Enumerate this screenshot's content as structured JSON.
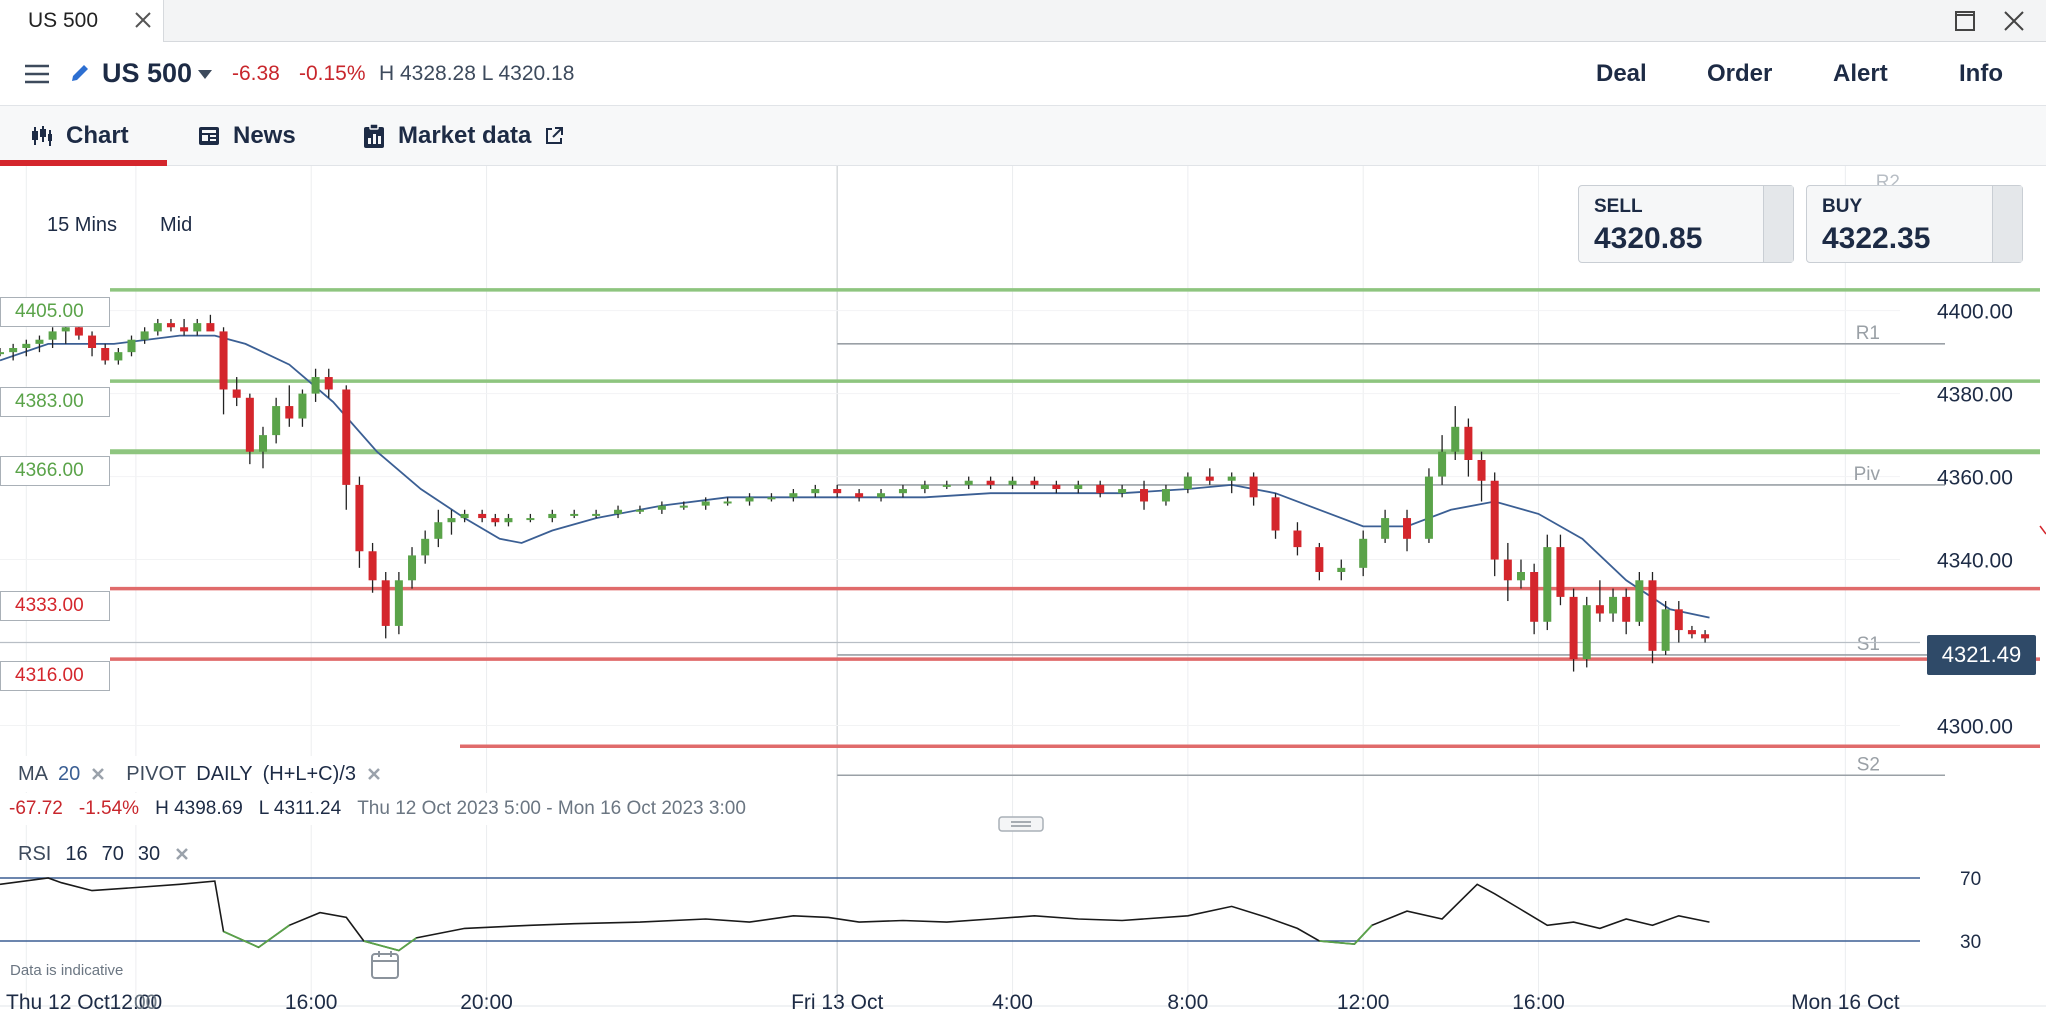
{
  "window": {
    "tab_title": "US 500"
  },
  "header": {
    "instrument": "US 500",
    "change_abs": "-6.38",
    "change_pct": "-0.15%",
    "high_low": "H 4328.28  L 4320.18",
    "buttons": {
      "deal": "Deal",
      "order": "Order",
      "alert": "Alert",
      "info": "Info"
    }
  },
  "tabs": {
    "chart": "Chart",
    "news": "News",
    "market_data": "Market data"
  },
  "chart_options": {
    "interval": "15 Mins",
    "price_type": "Mid"
  },
  "quote": {
    "sell_label": "SELL",
    "sell_value": "4320.85",
    "buy_label": "BUY",
    "buy_value": "4322.35"
  },
  "level_tags": {
    "l4405": "4405.00",
    "l4383": "4383.00",
    "l4366": "4366.00",
    "l4333": "4333.00",
    "l4316": "4316.00"
  },
  "last_price": "4321.49",
  "indicators": {
    "ma_label": "MA",
    "ma_period": "20",
    "pivot_label": "PIVOT",
    "pivot_period": "DAILY",
    "pivot_formula": "(H+L+C)/3"
  },
  "stats": {
    "change_abs": "-67.72",
    "change_pct": "-1.54%",
    "high": "H 4398.69",
    "low": "L 4311.24",
    "range": "Thu 12 Oct 2023 5:00 - Mon 16 Oct 2023 3:00"
  },
  "rsi": {
    "label": "RSI",
    "period": "16",
    "upper": "70",
    "lower": "30"
  },
  "disclaimer": "Data is indicative",
  "colors": {
    "up": "#5aa349",
    "down": "#d4262c",
    "ma": "#3b5f94",
    "rsi_oversold": "#5aa349",
    "support_line": "#8ec57f",
    "resistance_line": "#e06b6b",
    "brand_red": "#d4262c"
  },
  "chart_data": {
    "type": "candlestick",
    "interval": "15 Mins",
    "y_axis": {
      "min": 4283,
      "max": 4445,
      "ticks": [
        4300,
        4320,
        4340,
        4360,
        4380,
        4400
      ],
      "tick_labels": [
        "4300.00",
        "",
        "4340.00",
        "4360.00",
        "4380.00",
        "4400.00"
      ]
    },
    "x_axis": {
      "ticks": [
        {
          "t": 0.5,
          "label": "Thu 12 Oct"
        },
        {
          "t": 3,
          "label": "12:00"
        },
        {
          "t": 7,
          "label": "16:00"
        },
        {
          "t": 11,
          "label": "20:00"
        },
        {
          "t": 19,
          "label": "Fri 13 Oct"
        },
        {
          "t": 23,
          "label": "4:00"
        },
        {
          "t": 27,
          "label": "8:00"
        },
        {
          "t": 31,
          "label": "12:00"
        },
        {
          "t": 35,
          "label": "16:00"
        },
        {
          "t": 42,
          "label": "Mon 16 Oct"
        }
      ],
      "range": [
        -0.1,
        45.3
      ],
      "partial_label": "00"
    },
    "horizontal_levels": [
      {
        "value": 4405,
        "label": "4405.00",
        "color": "#8ec57f"
      },
      {
        "value": 4383,
        "label": "4383.00",
        "color": "#8ec57f"
      },
      {
        "value": 4366,
        "label": "4366.00",
        "color": "#8ec57f"
      },
      {
        "value": 4333,
        "label": "4333.00",
        "color": "#e06b6b"
      },
      {
        "value": 4316,
        "label": "4316.00",
        "color": "#e06b6b"
      },
      {
        "value": 4295,
        "label": "",
        "color": "#e06b6b"
      }
    ],
    "pivots": [
      {
        "name": "R2",
        "value": 4441
      },
      {
        "name": "R1",
        "value": 4392
      },
      {
        "name": "Piv",
        "value": 4358
      },
      {
        "name": "S1",
        "value": 4317
      },
      {
        "name": "S2",
        "value": 4288
      }
    ],
    "ohlc": [
      [
        -0.1,
        4390,
        4391,
        4389,
        4390
      ],
      [
        0.2,
        4390,
        4392,
        4388,
        4391
      ],
      [
        0.5,
        4391,
        4393,
        4389,
        4392
      ],
      [
        0.8,
        4392,
        4394,
        4390,
        4393
      ],
      [
        1.1,
        4393,
        4396,
        4391,
        4395
      ],
      [
        1.4,
        4395,
        4397,
        4392,
        4396
      ],
      [
        1.7,
        4396,
        4397,
        4393,
        4394
      ],
      [
        2.0,
        4394,
        4395,
        4389,
        4391
      ],
      [
        2.3,
        4391,
        4392,
        4387,
        4388
      ],
      [
        2.6,
        4388,
        4391,
        4387,
        4390
      ],
      [
        2.9,
        4390,
        4394,
        4389,
        4393
      ],
      [
        3.2,
        4393,
        4396,
        4392,
        4395
      ],
      [
        3.5,
        4395,
        4398,
        4394,
        4397
      ],
      [
        3.8,
        4397,
        4398,
        4395,
        4396
      ],
      [
        4.1,
        4396,
        4398,
        4394,
        4395
      ],
      [
        4.4,
        4395,
        4398,
        4394,
        4397
      ],
      [
        4.7,
        4397,
        4399,
        4396,
        4395
      ],
      [
        5.0,
        4395,
        4396,
        4375,
        4381
      ],
      [
        5.3,
        4381,
        4384,
        4377,
        4379
      ],
      [
        5.6,
        4379,
        4380,
        4363,
        4366
      ],
      [
        5.9,
        4366,
        4372,
        4362,
        4370
      ],
      [
        6.2,
        4370,
        4379,
        4368,
        4377
      ],
      [
        6.5,
        4377,
        4382,
        4372,
        4374
      ],
      [
        6.8,
        4374,
        4381,
        4372,
        4380
      ],
      [
        7.1,
        4380,
        4386,
        4378,
        4384
      ],
      [
        7.4,
        4384,
        4386,
        4379,
        4381
      ],
      [
        7.8,
        4381,
        4382,
        4352,
        4358
      ],
      [
        8.1,
        4358,
        4360,
        4338,
        4342
      ],
      [
        8.4,
        4342,
        4344,
        4332,
        4335
      ],
      [
        8.7,
        4335,
        4337,
        4321,
        4324
      ],
      [
        9.0,
        4324,
        4337,
        4322,
        4335
      ],
      [
        9.3,
        4335,
        4343,
        4333,
        4341
      ],
      [
        9.6,
        4341,
        4347,
        4339,
        4345
      ],
      [
        9.9,
        4345,
        4352,
        4343,
        4349
      ],
      [
        10.2,
        4349,
        4352,
        4346,
        4350
      ],
      [
        10.5,
        4350,
        4352,
        4349,
        4351
      ],
      [
        10.9,
        4351,
        4352,
        4349,
        4350
      ],
      [
        11.2,
        4350,
        4351,
        4348,
        4349
      ],
      [
        11.5,
        4349,
        4351,
        4348,
        4350
      ],
      [
        12.0,
        4350,
        4351,
        4349,
        4350
      ],
      [
        12.5,
        4350,
        4352,
        4349,
        4351
      ],
      [
        13.0,
        4351,
        4352,
        4350,
        4351
      ],
      [
        13.5,
        4351,
        4352,
        4350,
        4351
      ],
      [
        14.0,
        4351,
        4353,
        4350,
        4352
      ],
      [
        14.5,
        4352,
        4353,
        4351,
        4352
      ],
      [
        15.0,
        4352,
        4354,
        4351,
        4353
      ],
      [
        15.5,
        4353,
        4354,
        4352,
        4353
      ],
      [
        16.0,
        4353,
        4355,
        4352,
        4354
      ],
      [
        16.5,
        4354,
        4355,
        4353,
        4354
      ],
      [
        17.0,
        4354,
        4356,
        4353,
        4355
      ],
      [
        17.5,
        4355,
        4356,
        4354,
        4355
      ],
      [
        18.0,
        4355,
        4357,
        4354,
        4356
      ],
      [
        18.5,
        4356,
        4358,
        4355,
        4357
      ],
      [
        19.0,
        4357,
        4358,
        4355,
        4356
      ],
      [
        19.5,
        4356,
        4357,
        4354,
        4355
      ],
      [
        20.0,
        4355,
        4357,
        4354,
        4356
      ],
      [
        20.5,
        4356,
        4358,
        4355,
        4357
      ],
      [
        21.0,
        4357,
        4359,
        4356,
        4358
      ],
      [
        21.5,
        4358,
        4359,
        4357,
        4358
      ],
      [
        22.0,
        4358,
        4360,
        4357,
        4359
      ],
      [
        22.5,
        4359,
        4360,
        4357,
        4358
      ],
      [
        23.0,
        4358,
        4360,
        4357,
        4359
      ],
      [
        23.5,
        4359,
        4360,
        4357,
        4358
      ],
      [
        24.0,
        4358,
        4359,
        4356,
        4357
      ],
      [
        24.5,
        4357,
        4359,
        4356,
        4358
      ],
      [
        25.0,
        4358,
        4359,
        4355,
        4356
      ],
      [
        25.5,
        4356,
        4358,
        4355,
        4357
      ],
      [
        26.0,
        4357,
        4359,
        4352,
        4354
      ],
      [
        26.5,
        4354,
        4358,
        4353,
        4357
      ],
      [
        27.0,
        4357,
        4361,
        4356,
        4360
      ],
      [
        27.5,
        4360,
        4362,
        4358,
        4359
      ],
      [
        28.0,
        4359,
        4361,
        4356,
        4360
      ],
      [
        28.5,
        4360,
        4361,
        4353,
        4355
      ],
      [
        29.0,
        4355,
        4356,
        4345,
        4347
      ],
      [
        29.5,
        4347,
        4349,
        4341,
        4343
      ],
      [
        30.0,
        4343,
        4344,
        4335,
        4337
      ],
      [
        30.5,
        4337,
        4340,
        4335,
        4338
      ],
      [
        31.0,
        4338,
        4347,
        4336,
        4345
      ],
      [
        31.5,
        4345,
        4352,
        4344,
        4350
      ],
      [
        32.0,
        4350,
        4352,
        4342,
        4345
      ],
      [
        32.5,
        4345,
        4362,
        4344,
        4360
      ],
      [
        32.8,
        4360,
        4370,
        4358,
        4366
      ],
      [
        33.1,
        4366,
        4377,
        4364,
        4372
      ],
      [
        33.4,
        4372,
        4374,
        4360,
        4364
      ],
      [
        33.7,
        4364,
        4366,
        4354,
        4359
      ],
      [
        34.0,
        4359,
        4361,
        4336,
        4340
      ],
      [
        34.3,
        4340,
        4344,
        4330,
        4335
      ],
      [
        34.6,
        4335,
        4340,
        4333,
        4337
      ],
      [
        34.9,
        4337,
        4339,
        4322,
        4325
      ],
      [
        35.2,
        4325,
        4346,
        4323,
        4343
      ],
      [
        35.5,
        4343,
        4346,
        4329,
        4331
      ],
      [
        35.8,
        4331,
        4333,
        4313,
        4316
      ],
      [
        36.1,
        4316,
        4331,
        4314,
        4329
      ],
      [
        36.4,
        4329,
        4335,
        4325,
        4327
      ],
      [
        36.7,
        4327,
        4333,
        4325,
        4331
      ],
      [
        37.0,
        4331,
        4333,
        4322,
        4325
      ],
      [
        37.3,
        4325,
        4337,
        4324,
        4335
      ],
      [
        37.6,
        4335,
        4337,
        4315,
        4318
      ],
      [
        37.9,
        4318,
        4330,
        4317,
        4328
      ],
      [
        38.2,
        4328,
        4330,
        4320,
        4323
      ],
      [
        38.5,
        4323,
        4324,
        4321,
        4322
      ],
      [
        38.8,
        4322,
        4323,
        4320,
        4321
      ]
    ],
    "ma20": [
      [
        -0.1,
        4388
      ],
      [
        1.0,
        4392
      ],
      [
        2.5,
        4392
      ],
      [
        4.0,
        4394
      ],
      [
        4.8,
        4394
      ],
      [
        5.5,
        4392
      ],
      [
        6.5,
        4387
      ],
      [
        7.5,
        4378
      ],
      [
        8.5,
        4366
      ],
      [
        9.5,
        4357
      ],
      [
        10.5,
        4350
      ],
      [
        11.3,
        4345
      ],
      [
        11.8,
        4344
      ],
      [
        12.5,
        4347
      ],
      [
        13.5,
        4350
      ],
      [
        15.0,
        4353
      ],
      [
        16.5,
        4355
      ],
      [
        18.0,
        4355
      ],
      [
        19.5,
        4355
      ],
      [
        21.0,
        4355
      ],
      [
        22.5,
        4356
      ],
      [
        24.0,
        4356
      ],
      [
        25.5,
        4356
      ],
      [
        27.0,
        4357
      ],
      [
        28.0,
        4358
      ],
      [
        29.0,
        4356
      ],
      [
        30.0,
        4352
      ],
      [
        31.0,
        4348
      ],
      [
        32.0,
        4348
      ],
      [
        33.0,
        4352
      ],
      [
        34.0,
        4354
      ],
      [
        35.0,
        4351
      ],
      [
        36.0,
        4345
      ],
      [
        37.0,
        4335
      ],
      [
        38.0,
        4328
      ],
      [
        38.9,
        4326
      ]
    ],
    "rsi": {
      "upper": 70,
      "lower": 30,
      "values": [
        [
          -0.1,
          66
        ],
        [
          1.0,
          70
        ],
        [
          1.3,
          67
        ],
        [
          2.0,
          62
        ],
        [
          3.0,
          64
        ],
        [
          4.0,
          66
        ],
        [
          4.8,
          68
        ],
        [
          5.0,
          36
        ],
        [
          5.8,
          26
        ],
        [
          6.5,
          40
        ],
        [
          7.2,
          48
        ],
        [
          7.8,
          45
        ],
        [
          8.2,
          30
        ],
        [
          9.0,
          24
        ],
        [
          9.4,
          32
        ],
        [
          10.5,
          38
        ],
        [
          12.0,
          40
        ],
        [
          13.0,
          41
        ],
        [
          14.5,
          42
        ],
        [
          16.0,
          44
        ],
        [
          17.0,
          42
        ],
        [
          18.0,
          46
        ],
        [
          18.8,
          45
        ],
        [
          19.5,
          42
        ],
        [
          20.5,
          43
        ],
        [
          21.5,
          42
        ],
        [
          22.5,
          44
        ],
        [
          23.5,
          46
        ],
        [
          24.5,
          44
        ],
        [
          25.5,
          43
        ],
        [
          27.0,
          46
        ],
        [
          28.0,
          52
        ],
        [
          28.8,
          45
        ],
        [
          29.5,
          38
        ],
        [
          30.0,
          30
        ],
        [
          30.8,
          28
        ],
        [
          31.2,
          40
        ],
        [
          32.0,
          49
        ],
        [
          32.8,
          44
        ],
        [
          33.6,
          66
        ],
        [
          34.0,
          60
        ],
        [
          34.6,
          50
        ],
        [
          35.2,
          40
        ],
        [
          35.8,
          42
        ],
        [
          36.4,
          38
        ],
        [
          37.0,
          44
        ],
        [
          37.6,
          40
        ],
        [
          38.2,
          46
        ],
        [
          38.9,
          42
        ]
      ]
    }
  }
}
